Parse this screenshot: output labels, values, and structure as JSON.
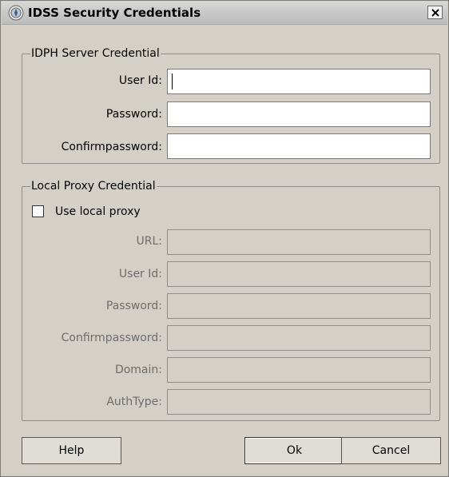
{
  "window": {
    "title": "IDSS Security Credentials",
    "close_glyph": "✕"
  },
  "server_group": {
    "legend": "IDPH Server Credential",
    "fields": [
      {
        "label": "User Id:",
        "value": ""
      },
      {
        "label": "Password:",
        "value": ""
      },
      {
        "label": "Confirmpassword:",
        "value": ""
      }
    ]
  },
  "proxy_group": {
    "legend": "Local Proxy Credential",
    "use_proxy_label": "Use local proxy",
    "use_proxy_checked": false,
    "fields": [
      {
        "label": "URL:",
        "value": ""
      },
      {
        "label": "User Id:",
        "value": ""
      },
      {
        "label": "Password:",
        "value": ""
      },
      {
        "label": "Confirmpassword:",
        "value": ""
      },
      {
        "label": "Domain:",
        "value": ""
      },
      {
        "label": "AuthType:",
        "value": ""
      }
    ]
  },
  "buttons": {
    "help": "Help",
    "ok": "Ok",
    "cancel": "Cancel"
  },
  "icons": {
    "title_icon": "seal-icon",
    "close": "close-icon"
  },
  "colors": {
    "dialog_bg": "#d4d0c8",
    "disabled_text": "#6d6d6d"
  }
}
